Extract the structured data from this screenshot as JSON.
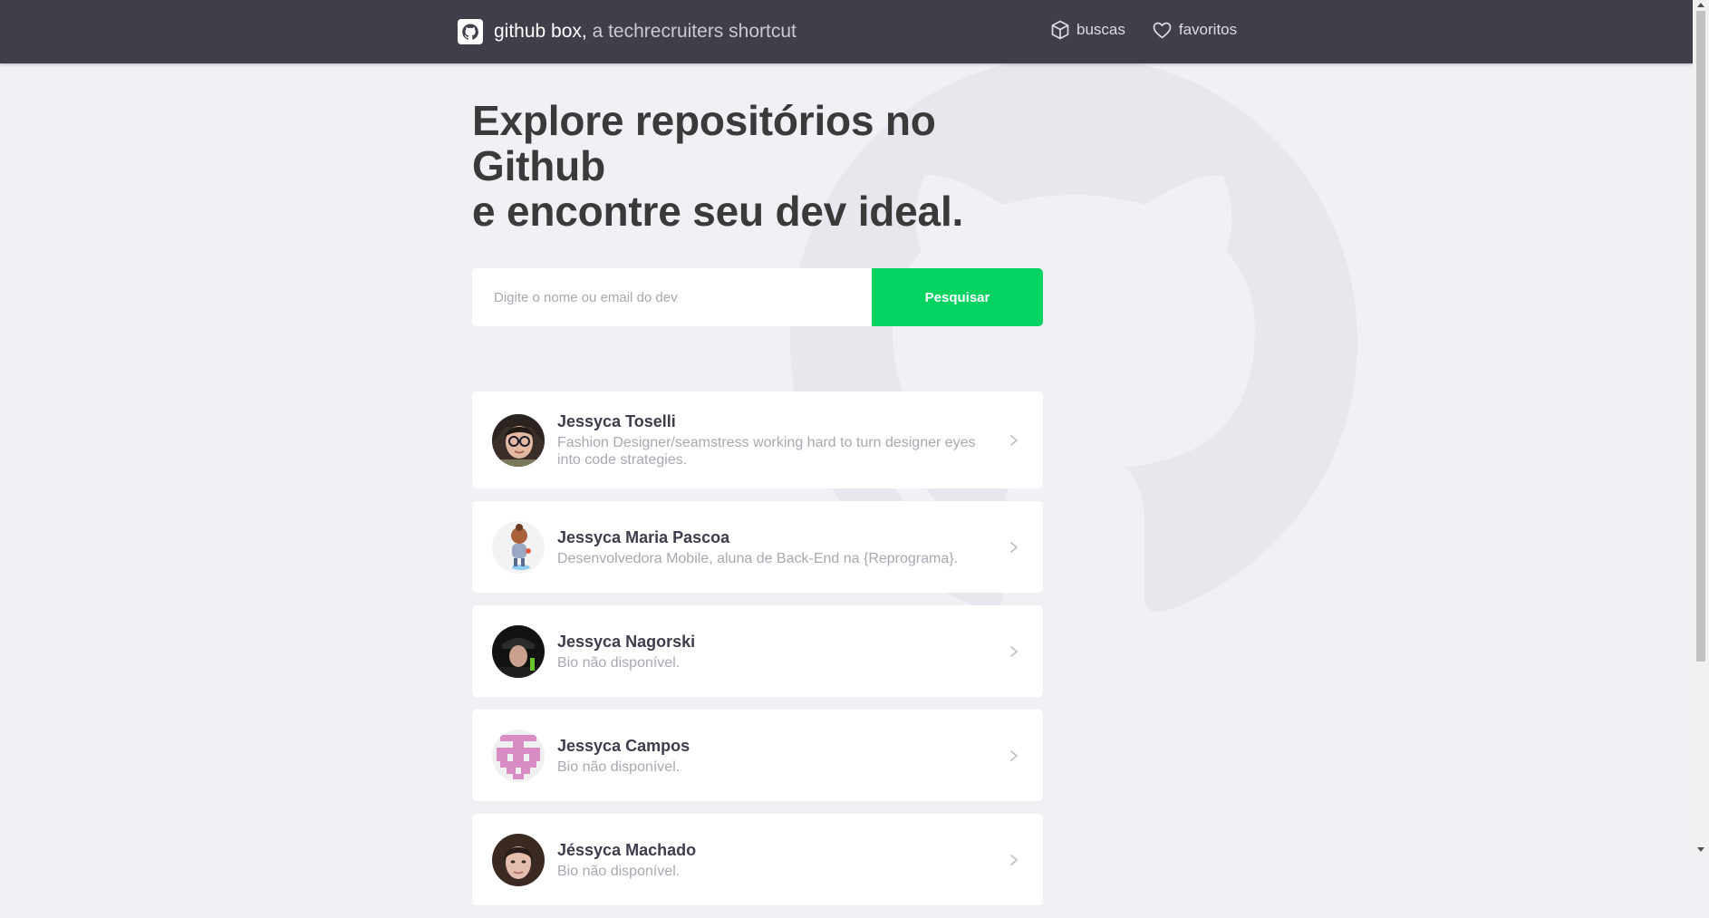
{
  "header": {
    "brand_name": "github box,",
    "brand_tagline": " a techrecruiters shortcut",
    "nav": [
      {
        "label": "buscas",
        "icon": "box-icon"
      },
      {
        "label": "favoritos",
        "icon": "heart-icon"
      }
    ]
  },
  "main": {
    "headline_line1": "Explore repositórios no Github",
    "headline_line2": "e encontre seu dev ideal.",
    "search": {
      "placeholder": "Digite o nome ou email do dev",
      "value": "",
      "button_label": "Pesquisar"
    },
    "results": [
      {
        "name": "Jessyca Toselli",
        "bio": "Fashion Designer/seamstress working hard to turn designer eyes into code strategies."
      },
      {
        "name": "Jessyca Maria Pascoa",
        "bio": "Desenvolvedora Mobile, aluna de Back-End na {Reprograma}."
      },
      {
        "name": "Jessyca Nagorski",
        "bio": "Bio não disponível."
      },
      {
        "name": "Jessyca Campos",
        "bio": "Bio não disponível."
      },
      {
        "name": "Jéssyca Machado",
        "bio": "Bio não disponível."
      }
    ]
  },
  "colors": {
    "topbar": "#3f3f4a",
    "background": "#f0f0f5",
    "accent": "#04d361",
    "text": "#3a3a3a",
    "muted": "#a8a8b3"
  }
}
